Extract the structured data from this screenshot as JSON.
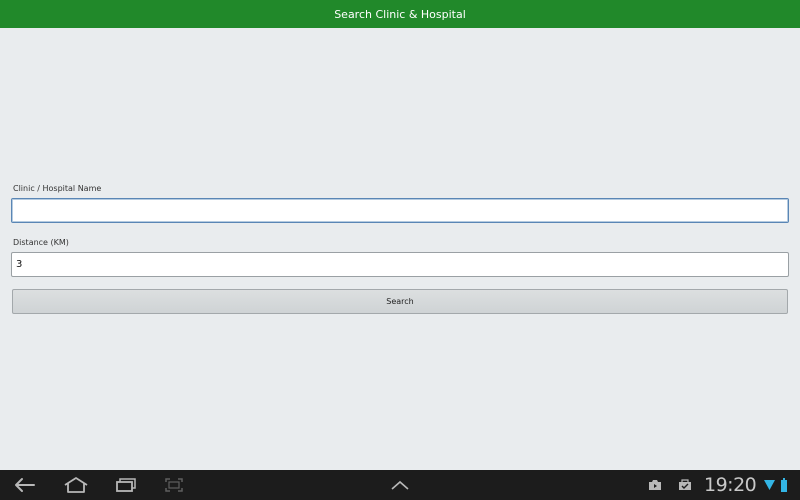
{
  "header": {
    "title": "Search Clinic & Hospital"
  },
  "form": {
    "name_label": "Clinic / Hospital Name",
    "name_value": "",
    "distance_label": "Distance (KM)",
    "distance_value": "3",
    "search_label": "Search"
  },
  "status_bar": {
    "time": "19:20",
    "icons": [
      "camera-icon",
      "shopping-bag-icon",
      "wifi-icon",
      "battery-icon"
    ]
  },
  "nav_bar": {
    "icons": [
      "back-icon",
      "home-icon",
      "recent-apps-icon",
      "screenshot-icon",
      "chevron-up-icon"
    ]
  },
  "colors": {
    "header_bg": "#21892a",
    "background": "#e9ecee",
    "navbar_bg": "#1c1c1c",
    "accent_blue": "#33b5e5"
  }
}
